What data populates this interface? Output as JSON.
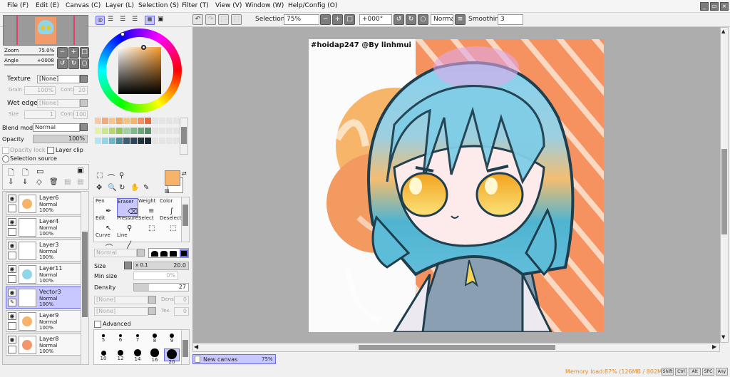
{
  "menu": [
    "File (F)",
    "Edit (E)",
    "Canvas (C)",
    "Layer (L)",
    "Selection (S)",
    "Filter (T)",
    "View (V)",
    "Window (W)",
    "Help/Config (O)"
  ],
  "toolbar": {
    "selection_label": "Selection",
    "zoom": "75%",
    "angle": "+000°",
    "blend": "Normal",
    "smoothing_label": "Smoothing",
    "smoothing": "3"
  },
  "navigator": {
    "zoom_label": "Zoom",
    "zoom": "75.0%",
    "angle_label": "Angle",
    "angle": "+0008"
  },
  "texture": {
    "label": "Texture",
    "value": "[None]",
    "grain_label": "Grain",
    "grain": "100%",
    "contr_label": "Contr",
    "contr": "20"
  },
  "wet_edge": {
    "label": "Wet edge",
    "value": "[None]",
    "size_label": "Size",
    "size": "1",
    "contr_label": "Contr",
    "contr": "100"
  },
  "blend": {
    "label": "Blend mode",
    "value": "Normal",
    "opacity_label": "Opacity",
    "opacity": "100%",
    "opacity_value": 1.0,
    "opacity_lock": "Opacity lock",
    "layer_clip": "Layer clip",
    "selection_source": "Selection source"
  },
  "layers": [
    {
      "name": "Layer6",
      "mode": "Normal",
      "opacity": "100%",
      "thumb": "#f6b46a"
    },
    {
      "name": "Layer4",
      "mode": "Normal",
      "opacity": "100%",
      "thumb": "#ffffff"
    },
    {
      "name": "Layer3",
      "mode": "Normal",
      "opacity": "100%",
      "thumb": "#ffffff"
    },
    {
      "name": "Layer11",
      "mode": "Normal",
      "opacity": "100%",
      "thumb": "#8fd6e6"
    },
    {
      "name": "Vector3",
      "mode": "Normal",
      "opacity": "100%",
      "thumb": "#ffffff"
    },
    {
      "name": "Layer9",
      "mode": "Normal",
      "opacity": "100%",
      "thumb": "#f6b46a"
    },
    {
      "name": "Layer8",
      "mode": "Normal",
      "opacity": "100%",
      "thumb": "#f4956a"
    }
  ],
  "selected_layer": "Vector3",
  "tools": [
    {
      "label": "Pen",
      "icon": "pen-icon"
    },
    {
      "label": "Eraser",
      "icon": "eraser-icon"
    },
    {
      "label": "Weight",
      "icon": "weight-icon"
    },
    {
      "label": "Color",
      "icon": "color-icon"
    },
    {
      "label": "Edit",
      "icon": "edit-icon"
    },
    {
      "label": "Pressure",
      "icon": "pressure-icon"
    },
    {
      "label": "Select",
      "icon": "select-icon"
    },
    {
      "label": "Deselect",
      "icon": "deselect-icon"
    },
    {
      "label": "Curve",
      "icon": "curve-icon"
    },
    {
      "label": "Line",
      "icon": "line-icon"
    }
  ],
  "brush": {
    "mode": "Normal",
    "size_label": "Size",
    "size_mult": "x 0.1",
    "size": "20.0",
    "min_size_label": "Min size",
    "min_size": "0%",
    "density_label": "Density",
    "density": "27",
    "density_value": 27,
    "none1": "[None]",
    "dens_label": "Dens",
    "dens": "0",
    "none2": "[None]",
    "tex_label": "Tex.",
    "tex": "0",
    "advanced": "Advanced"
  },
  "brush_sizes": [
    "5",
    "6",
    "7",
    "8",
    "9",
    "10",
    "12",
    "14",
    "16",
    "20"
  ],
  "selected_brush_size": "20",
  "swatches": [
    "#f7c9a5",
    "#f5a97a",
    "#f6c58c",
    "#f4a860",
    "#f7c27e",
    "#f6b46a",
    "#f5915f",
    "#e86a3c",
    "#e4f2a8",
    "#cde88a",
    "#b5d86e",
    "#8fc95a",
    "#9dd3a0",
    "#7db98a",
    "#6aa87a",
    "#5a8e6c",
    "#aee6f2",
    "#8ed6e8",
    "#6ab8cc",
    "#4a8aa0",
    "#385f74",
    "#2a4658",
    "#203442",
    "#192a35"
  ],
  "canvas": {
    "watermark": "#hoidap247 @By linhmui",
    "tab_name": "New canvas",
    "tab_zoom": "75%"
  },
  "status": {
    "memory": "Memory load:87% (126MB / 802MB)",
    "keys": [
      "Shift",
      "Ctrl",
      "Alt",
      "SPC",
      "Any"
    ]
  },
  "colors": {
    "accent": "#c8c8ff",
    "primary": "#f6b46a",
    "secondary": "#ffffff",
    "memory_text": "#e08a2a"
  }
}
